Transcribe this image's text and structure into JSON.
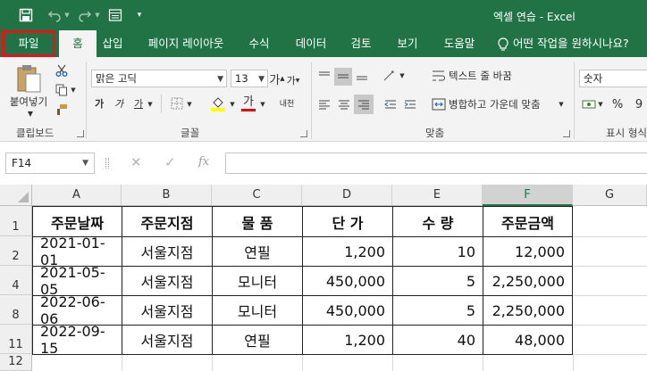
{
  "window": {
    "title": "엑셀 연습  -  Excel"
  },
  "tabs": [
    "파일",
    "홈",
    "삽입",
    "페이지 레이아웃",
    "수식",
    "데이터",
    "검토",
    "보기",
    "도움말"
  ],
  "tell_me": "어떤 작업을 원하시나요?",
  "ribbon": {
    "paste_label": "붙여넣기",
    "clipboard_label": "클립보드",
    "font_name": "맑은 고딕",
    "font_size": "13",
    "font_label": "글꼴",
    "wrap_text": "텍스트 줄 바꿈",
    "merge_center": "병합하고 가운데 맞춤",
    "alignment_label": "맞춤",
    "number_format": "숫자",
    "number_label": "표시 형식",
    "bold": "가",
    "italic": "가",
    "underline": "가",
    "font_grow": "가",
    "font_shrink": "가",
    "font_color": "가",
    "phonetic": "내천",
    "percent": "%",
    "comma": "9"
  },
  "formula_bar": {
    "name_box": "F14",
    "cancel": "✕",
    "enter": "✓",
    "fx": "fx",
    "value": ""
  },
  "columns": [
    "A",
    "B",
    "C",
    "D",
    "E",
    "F",
    "G"
  ],
  "selected_column": "F",
  "row_numbers": [
    "1",
    "2",
    "4",
    "8",
    "11",
    "12"
  ],
  "table": {
    "headers": [
      "주문날짜",
      "주문지점",
      "물 품",
      "단 가",
      "수 량",
      "주문금액"
    ],
    "rows": [
      [
        "2021-01-01",
        "서울지점",
        "연필",
        "1,200",
        "10",
        "12,000"
      ],
      [
        "2021-05-05",
        "서울지점",
        "모니터",
        "450,000",
        "5",
        "2,250,000"
      ],
      [
        "2022-06-06",
        "서울지점",
        "모니터",
        "450,000",
        "5",
        "2,250,000"
      ],
      [
        "2022-09-15",
        "서울지점",
        "연필",
        "1,200",
        "40",
        "48,000"
      ]
    ]
  },
  "colors": {
    "brand": "#217346",
    "highlight": "#e8131a"
  }
}
